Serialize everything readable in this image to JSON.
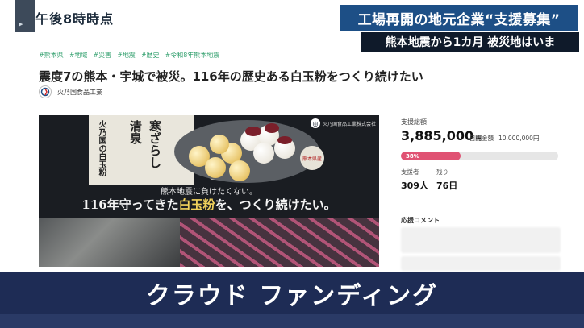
{
  "broadcast": {
    "time": "午後8時時点",
    "headline": "工場再開の地元企業“支援募集”",
    "subheadline": "熊本地震から1カ月 被災地はいま",
    "caption": "クラウド ファンディング"
  },
  "project": {
    "tags": [
      "#熊本県",
      "#地域",
      "#災害",
      "#地震",
      "#歴史",
      "#令和8年熊本地震"
    ],
    "title": "震度7の熊本・宇城で被災。116年の歴史ある白玉粉をつくり続けたい",
    "owner": "火乃国食品工業",
    "hero": {
      "package_brand": "火乃国の白玉粉",
      "package_name_1": "清泉",
      "package_name_2": "寒ざらし",
      "stamp": "熊本県産",
      "company": "火乃国食品工業株式会社",
      "caption_line1": "熊本地震に負けたくない。",
      "caption_line2_pre": "116年守ってきた",
      "caption_line2_hl": "白玉粉",
      "caption_line2_post": "を、つくり続けたい。"
    }
  },
  "funding": {
    "raised_label": "支援総額",
    "raised_amount": "3,885,000",
    "currency": "円",
    "goal_label": "目標金額",
    "goal_amount": "10,000,000円",
    "progress_percent": 38,
    "progress_label": "38%",
    "supporters_label": "支援者",
    "supporters_value": "309人",
    "remaining_label": "残り",
    "remaining_value": "76日",
    "comments_label": "応援コメント"
  },
  "colors": {
    "accent": "#e05273",
    "tag": "#2e9e6b",
    "banner": "#1e2c55",
    "headline_box": "#1d4f86"
  }
}
